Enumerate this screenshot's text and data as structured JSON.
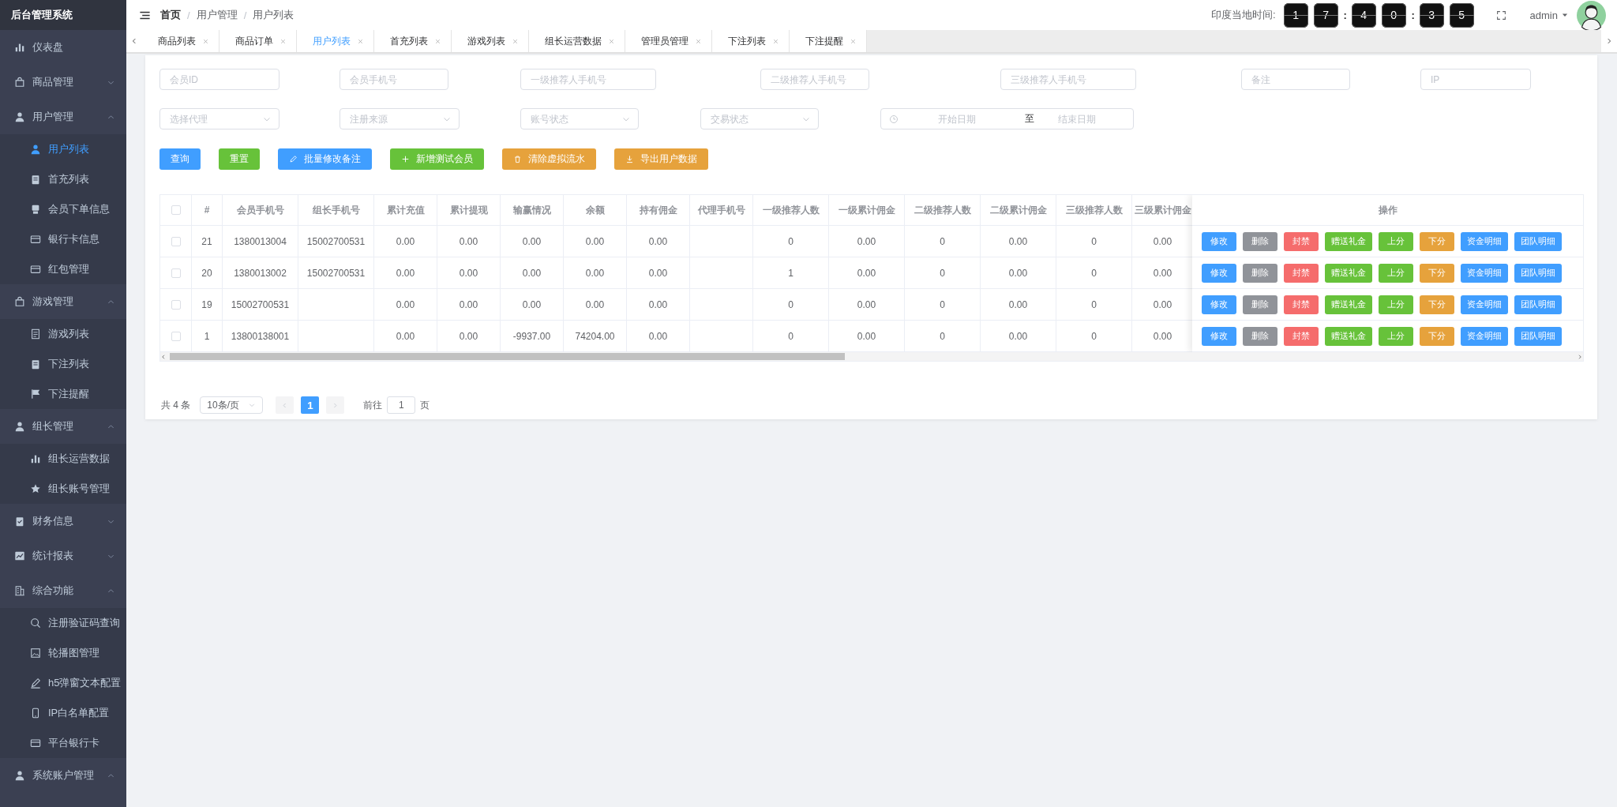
{
  "sidebar": {
    "title": "后台管理系统",
    "items": [
      {
        "label": "仪表盘",
        "selected": false
      },
      {
        "label": "商品管理",
        "selected": false,
        "expanded": false
      },
      {
        "label": "用户管理",
        "selected": false,
        "expanded": true,
        "children": [
          {
            "label": "用户列表",
            "selected": true
          },
          {
            "label": "首充列表",
            "selected": false
          },
          {
            "label": "会员下单信息",
            "selected": false
          },
          {
            "label": "银行卡信息",
            "selected": false
          },
          {
            "label": "红包管理",
            "selected": false
          }
        ]
      },
      {
        "label": "游戏管理",
        "selected": false,
        "expanded": true,
        "children": [
          {
            "label": "游戏列表",
            "selected": false
          },
          {
            "label": "下注列表",
            "selected": false
          },
          {
            "label": "下注提醒",
            "selected": false
          }
        ]
      },
      {
        "label": "组长管理",
        "selected": false,
        "expanded": true,
        "children": [
          {
            "label": "组长运营数据",
            "selected": false
          },
          {
            "label": "组长账号管理",
            "selected": false
          }
        ]
      },
      {
        "label": "财务信息",
        "selected": false,
        "expanded": false
      },
      {
        "label": "统计报表",
        "selected": false,
        "expanded": false
      },
      {
        "label": "综合功能",
        "selected": false,
        "expanded": true,
        "children": [
          {
            "label": "注册验证码查询",
            "selected": false
          },
          {
            "label": "轮播图管理",
            "selected": false
          },
          {
            "label": "h5弹窗文本配置",
            "selected": false
          },
          {
            "label": "IP白名单配置",
            "selected": false
          },
          {
            "label": "平台银行卡",
            "selected": false
          }
        ]
      },
      {
        "label": "系统账户管理",
        "selected": false,
        "expanded": true
      }
    ]
  },
  "header": {
    "breadcrumb": [
      {
        "kind": "link",
        "text": "首页"
      },
      {
        "kind": "separator",
        "text": "/"
      },
      {
        "kind": "link",
        "text": "用户管理"
      },
      {
        "kind": "separator",
        "text": "/"
      },
      {
        "kind": "link",
        "text": "用户列表"
      }
    ],
    "clock_label": "印度当地时间:",
    "clock": [
      {
        "kind": "digit",
        "text": "1"
      },
      {
        "kind": "digit",
        "text": "7"
      },
      {
        "kind": "colon",
        "text": ":"
      },
      {
        "kind": "digit",
        "text": "4"
      },
      {
        "kind": "digit",
        "text": "0"
      },
      {
        "kind": "colon",
        "text": ":"
      },
      {
        "kind": "digit",
        "text": "3"
      },
      {
        "kind": "digit",
        "text": "5"
      }
    ],
    "user": "admin"
  },
  "tabs": [
    {
      "label": "商品列表",
      "selected": false
    },
    {
      "label": "商品订单",
      "selected": false
    },
    {
      "label": "用户列表",
      "selected": true
    },
    {
      "label": "首充列表",
      "selected": false
    },
    {
      "label": "游戏列表",
      "selected": false
    },
    {
      "label": "组长运营数据",
      "selected": false
    },
    {
      "label": "管理员管理",
      "selected": false
    },
    {
      "label": "下注列表",
      "selected": false
    },
    {
      "label": "下注提醒",
      "selected": false
    }
  ],
  "filters": {
    "inputs": [
      {
        "placeholder": "会员ID"
      },
      {
        "placeholder": "会员手机号"
      },
      {
        "placeholder": "一级推荐人手机号"
      },
      {
        "placeholder": "二级推荐人手机号"
      },
      {
        "placeholder": "三级推荐人手机号"
      },
      {
        "placeholder": "备注"
      },
      {
        "placeholder": "IP"
      }
    ],
    "selects": [
      {
        "placeholder": "选择代理"
      },
      {
        "placeholder": "注册来源"
      },
      {
        "placeholder": "账号状态"
      },
      {
        "placeholder": "交易状态"
      }
    ],
    "date_range": {
      "start_placeholder": "开始日期",
      "separator": "至",
      "end_placeholder": "结束日期"
    }
  },
  "buttons": [
    {
      "label": "查询",
      "color": "#409eff"
    },
    {
      "label": "重置",
      "color": "#67c23a"
    },
    {
      "label": "批量修改备注",
      "color": "#409eff"
    },
    {
      "label": "新增测试会员",
      "color": "#67c23a"
    },
    {
      "label": "清除虚拟流水",
      "color": "#e6a23c"
    },
    {
      "label": "导出用户数据",
      "color": "#e6a23c"
    }
  ],
  "table": {
    "all_checked": false,
    "columns": [
      "#",
      "会员手机号",
      "组长手机号",
      "累计充值",
      "累计提现",
      "输赢情况",
      "余额",
      "持有佣金",
      "代理手机号",
      "一级推荐人数",
      "一级累计佣金",
      "二级推荐人数",
      "二级累计佣金",
      "三级推荐人数",
      "三级累计佣金"
    ],
    "action_column": "操作",
    "rows": [
      {
        "checked": false,
        "cells": [
          "21",
          "1380013004",
          "15002700531",
          "0.00",
          "0.00",
          "0.00",
          "0.00",
          "0.00",
          "",
          "0",
          "0.00",
          "0",
          "0.00",
          "0",
          "0.00"
        ],
        "actions": [
          {
            "label": "修改",
            "color": "#409eff"
          },
          {
            "label": "删除",
            "color": "#909399"
          },
          {
            "label": "封禁",
            "color": "#f56c6c"
          },
          {
            "label": "赠送礼金",
            "color": "#67c23a"
          },
          {
            "label": "上分",
            "color": "#67c23a"
          },
          {
            "label": "下分",
            "color": "#e6a23c"
          },
          {
            "label": "资金明细",
            "color": "#409eff"
          },
          {
            "label": "团队明细",
            "color": "#409eff"
          }
        ]
      },
      {
        "checked": false,
        "cells": [
          "20",
          "1380013002",
          "15002700531",
          "0.00",
          "0.00",
          "0.00",
          "0.00",
          "0.00",
          "",
          "1",
          "0.00",
          "0",
          "0.00",
          "0",
          "0.00"
        ],
        "actions": [
          {
            "label": "修改",
            "color": "#409eff"
          },
          {
            "label": "删除",
            "color": "#909399"
          },
          {
            "label": "封禁",
            "color": "#f56c6c"
          },
          {
            "label": "赠送礼金",
            "color": "#67c23a"
          },
          {
            "label": "上分",
            "color": "#67c23a"
          },
          {
            "label": "下分",
            "color": "#e6a23c"
          },
          {
            "label": "资金明细",
            "color": "#409eff"
          },
          {
            "label": "团队明细",
            "color": "#409eff"
          }
        ]
      },
      {
        "checked": false,
        "cells": [
          "19",
          "15002700531",
          "",
          "0.00",
          "0.00",
          "0.00",
          "0.00",
          "0.00",
          "",
          "0",
          "0.00",
          "0",
          "0.00",
          "0",
          "0.00"
        ],
        "actions": [
          {
            "label": "修改",
            "color": "#409eff"
          },
          {
            "label": "删除",
            "color": "#909399"
          },
          {
            "label": "封禁",
            "color": "#f56c6c"
          },
          {
            "label": "赠送礼金",
            "color": "#67c23a"
          },
          {
            "label": "上分",
            "color": "#67c23a"
          },
          {
            "label": "下分",
            "color": "#e6a23c"
          },
          {
            "label": "资金明细",
            "color": "#409eff"
          },
          {
            "label": "团队明细",
            "color": "#409eff"
          }
        ]
      },
      {
        "checked": false,
        "cells": [
          "1",
          "13800138001",
          "",
          "0.00",
          "0.00",
          "-9937.00",
          "74204.00",
          "0.00",
          "",
          "0",
          "0.00",
          "0",
          "0.00",
          "0",
          "0.00"
        ],
        "actions": [
          {
            "label": "修改",
            "color": "#409eff"
          },
          {
            "label": "删除",
            "color": "#909399"
          },
          {
            "label": "封禁",
            "color": "#f56c6c"
          },
          {
            "label": "赠送礼金",
            "color": "#67c23a"
          },
          {
            "label": "上分",
            "color": "#67c23a"
          },
          {
            "label": "下分",
            "color": "#e6a23c"
          },
          {
            "label": "资金明细",
            "color": "#409eff"
          },
          {
            "label": "团队明细",
            "color": "#409eff"
          }
        ]
      }
    ]
  },
  "pagination": {
    "total": "共 4 条",
    "page_size": "10条/页",
    "pages": [
      {
        "label": "1",
        "selected": true
      }
    ],
    "goto_label": "前往",
    "goto_value": "1",
    "goto_suffix": "页"
  }
}
